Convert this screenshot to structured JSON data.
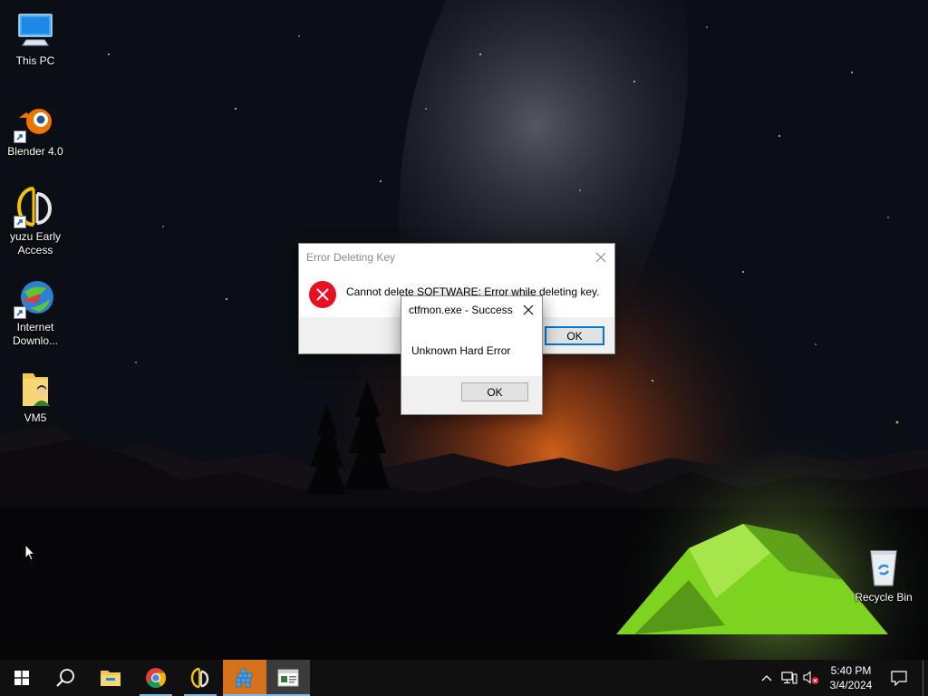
{
  "desktop": {
    "icons": [
      {
        "label": "This PC",
        "icon": "this-pc-icon"
      },
      {
        "label": "Blender 4.0",
        "icon": "blender-icon"
      },
      {
        "label": "yuzu Early Access",
        "icon": "yuzu-icon"
      },
      {
        "label": "Internet Downlo...",
        "icon": "internet-download-manager-icon"
      },
      {
        "label": "VM5",
        "icon": "folder-user-icon"
      },
      {
        "label": "Recycle Bin",
        "icon": "recycle-bin-icon"
      }
    ]
  },
  "dialogs": {
    "error_deleting_key": {
      "title": "Error Deleting Key",
      "message": "Cannot delete SOFTWARE:  Error while deleting key.",
      "ok_label": "OK",
      "icon": "error-icon"
    },
    "ctfmon": {
      "title": "ctfmon.exe - Success",
      "message": "Unknown Hard Error",
      "ok_label": "OK"
    }
  },
  "taskbar": {
    "buttons": [
      "start-icon",
      "search-icon",
      "file-explorer-icon",
      "chrome-icon",
      "yuzu-icon",
      "registry-editor-icon",
      "dialog-window-icon"
    ],
    "clock": {
      "time": "5:40 PM",
      "date": "3/4/2024"
    },
    "tray": [
      "show-hidden-icons-chevron",
      "network-icon",
      "volume-muted-icon",
      "notification-icon"
    ]
  },
  "colors": {
    "accent": "#0078d7",
    "taskbar": "#101010",
    "active_task_orange": "#d4731c",
    "error_red": "#e81123"
  }
}
